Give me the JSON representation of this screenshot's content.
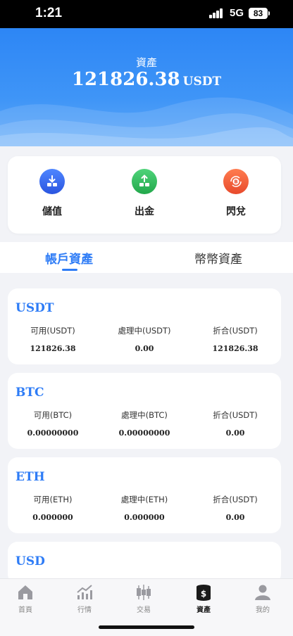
{
  "status_bar": {
    "time": "1:21",
    "network": "5G",
    "battery": "83"
  },
  "header": {
    "title": "資產",
    "amount": "121826.38",
    "unit": "USDT"
  },
  "actions": [
    {
      "label": "儲值",
      "icon": "deposit-icon",
      "color": "#3a6cf0"
    },
    {
      "label": "出金",
      "icon": "withdraw-icon",
      "color": "#2fbf5a"
    },
    {
      "label": "閃兌",
      "icon": "exchange-icon",
      "color": "#f2613c"
    }
  ],
  "tabs": [
    {
      "label": "帳戶資產",
      "active": true
    },
    {
      "label": "幣幣資產",
      "active": false
    }
  ],
  "assets": [
    {
      "name": "USDT",
      "col1_label": "可用(USDT)",
      "col1_value": "121826.38",
      "col2_label": "處理中(USDT)",
      "col2_value": "0.00",
      "col3_label": "折合(USDT)",
      "col3_value": "121826.38"
    },
    {
      "name": "BTC",
      "col1_label": "可用(BTC)",
      "col1_value": "0.00000000",
      "col2_label": "處理中(BTC)",
      "col2_value": "0.00000000",
      "col3_label": "折合(USDT)",
      "col3_value": "0.00"
    },
    {
      "name": "ETH",
      "col1_label": "可用(ETH)",
      "col1_value": "0.000000",
      "col2_label": "處理中(ETH)",
      "col2_value": "0.000000",
      "col3_label": "折合(USDT)",
      "col3_value": "0.00"
    },
    {
      "name": "USD"
    }
  ],
  "bottom_nav": [
    {
      "label": "首頁",
      "icon": "home-icon",
      "active": false
    },
    {
      "label": "行情",
      "icon": "market-chart-icon",
      "active": false
    },
    {
      "label": "交易",
      "icon": "candlestick-icon",
      "active": false
    },
    {
      "label": "資產",
      "icon": "coins-icon",
      "active": true
    },
    {
      "label": "我的",
      "icon": "profile-icon",
      "active": false
    }
  ],
  "colors": {
    "primary": "#2e7cf6",
    "header_start": "#2d86f5",
    "header_end": "#62aaf8"
  }
}
